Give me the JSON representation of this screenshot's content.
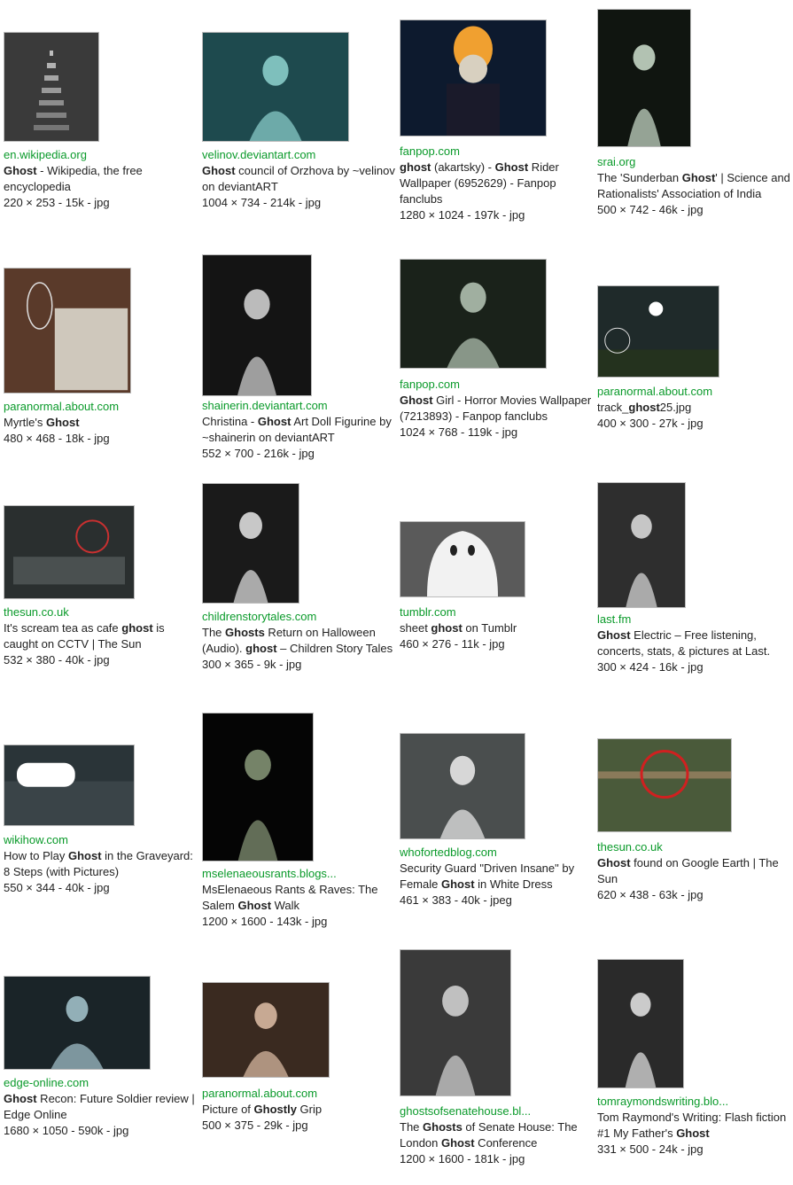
{
  "results": [
    {
      "site": "en.wikipedia.org",
      "title": [
        [
          "Ghost",
          true
        ],
        [
          " - Wikipedia, the free encyclopedia",
          false
        ]
      ],
      "dims": "220 × 253 - 15k - jpg",
      "bg": "#3a3a3a",
      "fg": "#cfcfcf",
      "icon": "staircase-image"
    },
    {
      "site": "velinov.deviantart.com",
      "title": [
        [
          "Ghost",
          true
        ],
        [
          " council of Orzhova by ~velinov on deviantART",
          false
        ]
      ],
      "dims": "1004 × 734 - 214k - jpg",
      "bg": "#1e4a4e",
      "fg": "#8fd3d0",
      "icon": "ghost-council-image"
    },
    {
      "site": "fanpop.com",
      "title": [
        [
          "ghost",
          true
        ],
        [
          " (akartsky) - ",
          false
        ],
        [
          "Ghost",
          true
        ],
        [
          " Rider Wallpaper (6952629) - Fanpop fanclubs",
          false
        ]
      ],
      "dims": "1280 × 1024 - 197k - jpg",
      "bg": "#0d1a2e",
      "fg": "#f0a030",
      "icon": "flaming-skull-image"
    },
    {
      "site": "srai.org",
      "title": [
        [
          "The 'Sunderban ",
          false
        ],
        [
          "Ghost",
          true
        ],
        [
          "' | Science and Rationalists' Association of India",
          false
        ]
      ],
      "dims": "500 × 742 - 46k - jpg",
      "bg": "#101510",
      "fg": "#cfe0cf",
      "icon": "night-figures-image"
    },
    {
      "site": "paranormal.about.com",
      "title": [
        [
          "Myrtle's ",
          false
        ],
        [
          "Ghost",
          true
        ]
      ],
      "dims": "480 × 468 - 18k - jpg",
      "bg": "#5a3a2a",
      "fg": "#d8c8b8",
      "icon": "old-woman-photo-image"
    },
    {
      "site": "shainerin.deviantart.com",
      "title": [
        [
          "Christina - ",
          false
        ],
        [
          "Ghost",
          true
        ],
        [
          " Art Doll Figurine by ~shainerin on deviantART",
          false
        ]
      ],
      "dims": "552 × 700 - 216k - jpg",
      "bg": "#141414",
      "fg": "#d8d8d8",
      "icon": "doll-figurine-image"
    },
    {
      "site": "fanpop.com",
      "title": [
        [
          "Ghost",
          true
        ],
        [
          " Girl - Horror Movies Wallpaper (7213893) - Fanpop fanclubs",
          false
        ]
      ],
      "dims": "1024 × 768 - 119k - jpg",
      "bg": "#1a221a",
      "fg": "#b8c8b8",
      "icon": "corridor-ghost-image"
    },
    {
      "site": "paranormal.about.com",
      "title": [
        [
          "track_",
          false
        ],
        [
          "ghost",
          true
        ],
        [
          "25.jpg",
          false
        ]
      ],
      "dims": "400 × 300 - 27k - jpg",
      "bg": "#1f2a2a",
      "fg": "#ffffff",
      "icon": "night-field-light-image"
    },
    {
      "site": "thesun.co.uk",
      "title": [
        [
          "It's scream tea as cafe ",
          false
        ],
        [
          "ghost",
          true
        ],
        [
          " is caught on CCTV | The Sun",
          false
        ]
      ],
      "dims": "532 × 380 - 40k - jpg",
      "bg": "#2a2f2f",
      "fg": "#c83030",
      "icon": "cctv-cafe-image"
    },
    {
      "site": "childrenstorytales.com",
      "title": [
        [
          "The ",
          false
        ],
        [
          "Ghosts",
          true
        ],
        [
          " Return on Halloween (Audio). ",
          false
        ],
        [
          "ghost",
          true
        ],
        [
          " – Children Story Tales",
          false
        ]
      ],
      "dims": "300 × 365 - 9k - jpg",
      "bg": "#1a1a1a",
      "fg": "#e8e8e8",
      "icon": "glowing-ghost-image"
    },
    {
      "site": "tumblr.com",
      "title": [
        [
          "sheet ",
          false
        ],
        [
          "ghost",
          true
        ],
        [
          " on Tumblr",
          false
        ]
      ],
      "dims": "460 × 276 - 11k - jpg",
      "bg": "#5a5a5a",
      "fg": "#f2f2f2",
      "icon": "sheet-ghost-image"
    },
    {
      "site": "last.fm",
      "title": [
        [
          "Ghost",
          true
        ],
        [
          " Electric – Free listening, concerts, stats, & pictures at Last.",
          false
        ]
      ],
      "dims": "300 × 424 - 16k - jpg",
      "bg": "#2e2e2e",
      "fg": "#e0e0e0",
      "icon": "veiled-figure-image"
    },
    {
      "site": "wikihow.com",
      "title": [
        [
          "How to Play ",
          false
        ],
        [
          "Ghost",
          true
        ],
        [
          " in the Graveyard: 8 Steps (with Pictures)",
          false
        ]
      ],
      "dims": "550 × 344 - 40k - jpg",
      "bg": "#2a3438",
      "fg": "#ffffff",
      "icon": "graveyard-illustration-image"
    },
    {
      "site": "mselenaeousrants.blogs...",
      "title": [
        [
          "MsElenaeous Rants & Raves: The Salem ",
          false
        ],
        [
          "Ghost",
          true
        ],
        [
          " Walk",
          false
        ]
      ],
      "dims": "1200 × 1600 - 143k - jpg",
      "bg": "#050505",
      "fg": "#8a9a7a",
      "icon": "dark-woman-photo-image"
    },
    {
      "site": "whofortedblog.com",
      "title": [
        [
          "Security Guard \"Driven Insane\" by Female ",
          false
        ],
        [
          "Ghost",
          true
        ],
        [
          " in White Dress",
          false
        ]
      ],
      "dims": "461 × 383 - 40k - jpeg",
      "bg": "#4a4e4e",
      "fg": "#f0f0f0",
      "icon": "white-dress-ghost-image"
    },
    {
      "site": "thesun.co.uk",
      "title": [
        [
          "Ghost",
          true
        ],
        [
          " found on Google Earth | The Sun",
          false
        ]
      ],
      "dims": "620 × 438 - 63k - jpg",
      "bg": "#4a5a3a",
      "fg": "#d02020",
      "icon": "aerial-view-image"
    },
    {
      "site": "edge-online.com",
      "title": [
        [
          "Ghost",
          true
        ],
        [
          " Recon: Future Soldier review | Edge Online",
          false
        ]
      ],
      "dims": "1680 × 1050 - 590k - jpg",
      "bg": "#1a2428",
      "fg": "#a8c8d0",
      "icon": "soldier-game-image"
    },
    {
      "site": "paranormal.about.com",
      "title": [
        [
          "Picture of ",
          false
        ],
        [
          "Ghostly",
          true
        ],
        [
          " Grip",
          false
        ]
      ],
      "dims": "500 × 375 - 29k - jpg",
      "bg": "#3a2a20",
      "fg": "#e0c0a8",
      "icon": "two-women-photo-image"
    },
    {
      "site": "ghostsofsenatehouse.bl...",
      "title": [
        [
          "The ",
          false
        ],
        [
          "Ghosts",
          true
        ],
        [
          " of Senate House: The London ",
          false
        ],
        [
          "Ghost",
          true
        ],
        [
          " Conference",
          false
        ]
      ],
      "dims": "1200 × 1600 - 181k - jpg",
      "bg": "#3a3a3a",
      "fg": "#d8d8d8",
      "icon": "hallway-ghost-image"
    },
    {
      "site": "tomraymondswriting.blo...",
      "title": [
        [
          "Tom Raymond's Writing: Flash fiction #1 My Father's ",
          false
        ],
        [
          "Ghost",
          true
        ]
      ],
      "dims": "331 × 500 - 24k - jpg",
      "bg": "#2a2a2a",
      "fg": "#e8e8e8",
      "icon": "garden-path-image"
    }
  ]
}
